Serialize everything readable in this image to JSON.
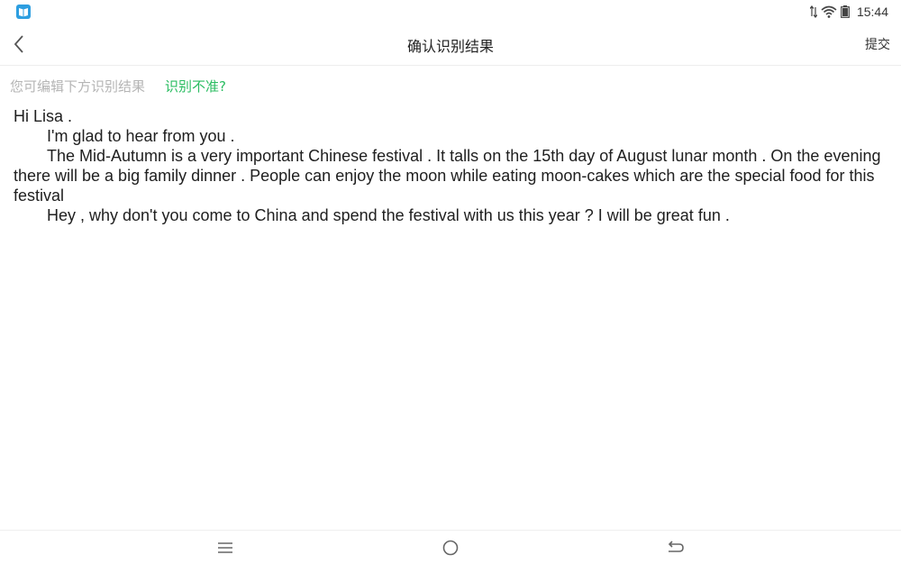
{
  "status_bar": {
    "app_icon": "book-icon",
    "icons": [
      "data-arrows-icon",
      "wifi-icon",
      "battery-icon"
    ],
    "time": "15:44"
  },
  "header": {
    "back_icon": "chevron-left-icon",
    "title": "确认识别结果",
    "submit_label": "提交"
  },
  "hint": {
    "text": "您可编辑下方识别结果",
    "link": "识别不准?"
  },
  "result": {
    "lines": [
      "Hi Lisa .",
      "I'm glad to hear from you .",
      "The Mid-Autumn is a very important Chinese festival . It talls on the 15th day of August lunar month . On the evening there will be a big family dinner . People can enjoy the moon while eating moon-cakes which are the special food for this festival",
      "Hey , why don't you come to China and spend the festival with us this year ? I will be great fun ."
    ]
  },
  "nav_bar": {
    "icons": [
      "menu-icon",
      "home-icon",
      "back-icon"
    ]
  },
  "colors": {
    "accent_green": "#2bbd62",
    "hint_gray": "#b5b5b5",
    "app_blue": "#2d9ee0"
  }
}
